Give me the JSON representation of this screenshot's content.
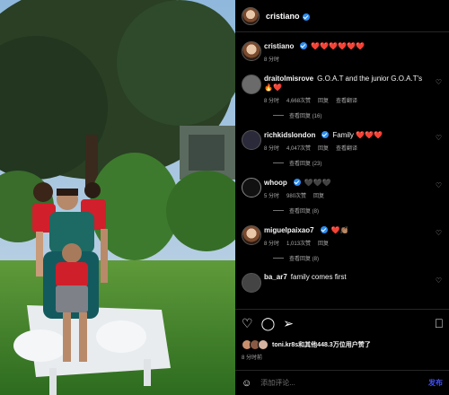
{
  "post": {
    "author": "cristiano",
    "caption": "❤️❤️❤️❤️❤️❤️",
    "caption_time": "8 分时"
  },
  "comments": [
    {
      "user": "draitolmisrove",
      "text": "G.O.A.T and the junior G.O.A.T's 🔥❤️",
      "time": "8 分时",
      "likes": "4,668次赞",
      "reply": "回复",
      "translate": "查看翻译",
      "replies": "查看回复 (16)",
      "verified": false
    },
    {
      "user": "richkidslondon",
      "text": "Family ❤️❤️❤️",
      "time": "8 分时",
      "likes": "4,047次赞",
      "reply": "回复",
      "translate": "查看翻译",
      "replies": "查看回复 (23)",
      "verified": true
    },
    {
      "user": "whoop",
      "text": "🖤🖤🖤",
      "time": "5 分时",
      "likes": "980次赞",
      "reply": "回复",
      "translate": "",
      "replies": "查看回复 (8)",
      "verified": true
    },
    {
      "user": "miguelpaixao7",
      "text": "❤️👏🏽",
      "time": "8 分时",
      "likes": "1,013次赞",
      "reply": "回复",
      "translate": "",
      "replies": "查看回复 (8)",
      "verified": true
    },
    {
      "user": "ba_ar7",
      "text": "family comes first",
      "time": "",
      "likes": "",
      "reply": "",
      "translate": "",
      "replies": "",
      "verified": false
    }
  ],
  "likes_text": "toni.kr8s和其他448.3万位用户赞了",
  "ago": "8 分时前",
  "composer": {
    "placeholder": "添加评论...",
    "post_label": "发布"
  },
  "colors": {
    "accent_blue": "#4150f7",
    "verified": "#2b8df2",
    "heart_red": "#ed2b3a"
  }
}
